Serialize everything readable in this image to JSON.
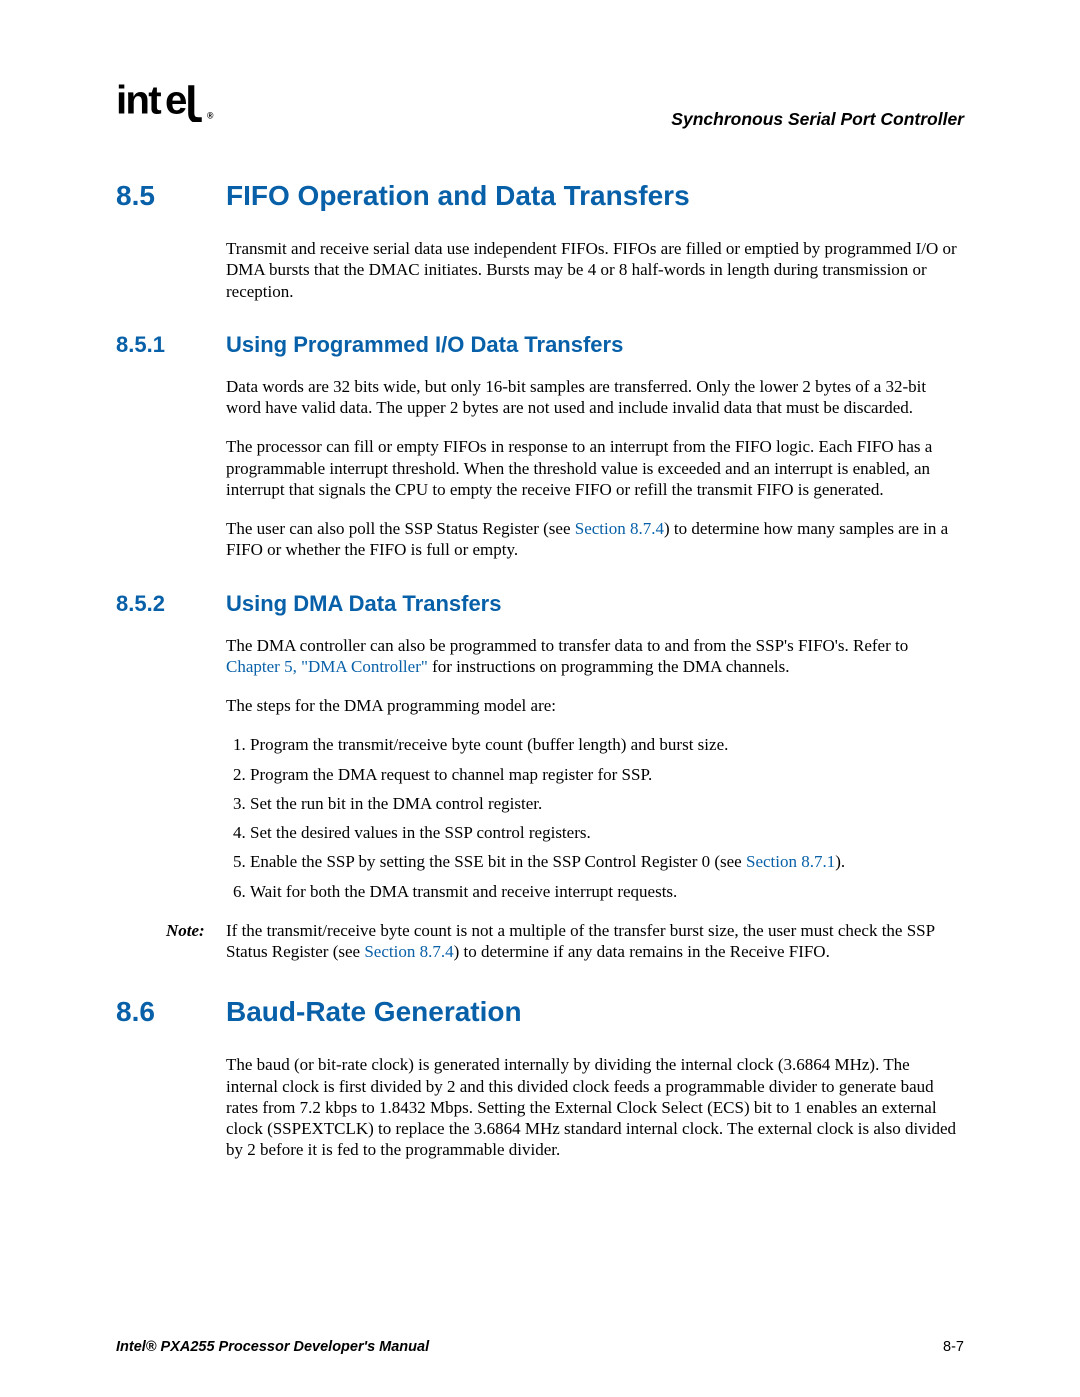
{
  "header": {
    "logo_text": "intel",
    "logo_mark": "®",
    "chapter_title": "Synchronous Serial Port Controller"
  },
  "s85": {
    "num": "8.5",
    "title": "FIFO Operation and Data Transfers",
    "p1": "Transmit and receive serial data use independent FIFOs. FIFOs are filled or emptied by programmed I/O or DMA bursts that the DMAC initiates. Bursts may be 4 or 8 half-words in length during transmission or reception."
  },
  "s851": {
    "num": "8.5.1",
    "title": "Using Programmed I/O Data Transfers",
    "p1": "Data words are 32 bits wide, but only 16-bit samples are transferred. Only the lower 2 bytes of a 32-bit word have valid data. The upper 2 bytes are not used and include invalid data that must be discarded.",
    "p2": "The processor can fill or empty FIFOs in response to an interrupt from the FIFO logic. Each FIFO has a programmable interrupt threshold. When the threshold value is exceeded and an interrupt is enabled, an interrupt that signals the CPU to empty the receive FIFO or refill the transmit FIFO is generated.",
    "p3a": "The user can also poll the SSP Status Register (see ",
    "p3link": "Section 8.7.4",
    "p3b": ") to determine how many samples are in a FIFO or whether the FIFO is full or empty."
  },
  "s852": {
    "num": "8.5.2",
    "title": "Using DMA Data Transfers",
    "p1a": "The DMA controller can also be programmed to transfer data to and from the SSP's FIFO's. Refer to ",
    "p1link": "Chapter 5, \"DMA Controller\"",
    "p1b": " for instructions on programming the DMA channels.",
    "p2": "The steps for the DMA programming model are:",
    "li1": "Program the transmit/receive byte count (buffer length) and burst size.",
    "li2": "Program the DMA request to channel map register for SSP.",
    "li3": "Set the run bit in the DMA control register.",
    "li4": "Set the desired values in the SSP control registers.",
    "li5a": "Enable the SSP by setting the SSE bit in the SSP Control Register 0 (see ",
    "li5link": "Section 8.7.1",
    "li5b": ").",
    "li6": "Wait for both the DMA transmit and receive interrupt requests.",
    "note_label": "Note:",
    "note_a": "If the transmit/receive byte count is not a multiple of the transfer burst size, the user must check the SSP Status Register (see ",
    "note_link": "Section 8.7.4",
    "note_b": ") to determine if any data remains in the Receive FIFO."
  },
  "s86": {
    "num": "8.6",
    "title": "Baud-Rate Generation",
    "p1": "The baud (or bit-rate clock) is generated internally by dividing the internal clock (3.6864 MHz). The internal clock is first divided by 2 and this divided clock feeds a programmable divider to generate baud rates from 7.2 kbps to 1.8432 Mbps. Setting the External Clock Select (ECS) bit to 1 enables an external clock (SSPEXTCLK) to replace the 3.6864 MHz standard internal clock. The external clock is also divided by 2 before it is fed to the programmable divider."
  },
  "footer": {
    "left": "Intel® PXA255 Processor Developer's Manual",
    "right": "8-7"
  }
}
